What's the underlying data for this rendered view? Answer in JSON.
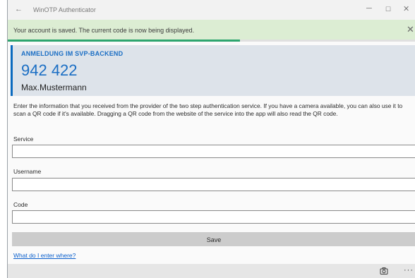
{
  "window": {
    "title": "WinOTP Authenticator",
    "back_glyph": "←",
    "minimize_glyph": "─",
    "maximize_glyph": "☐",
    "close_glyph": "✕"
  },
  "notification": {
    "message": "Your account is saved. The current code is now being displayed.",
    "close_glyph": "✕",
    "progress_fraction": 0.57
  },
  "account": {
    "label": "ANMELDUNG IM SVP-BACKEND",
    "code": "942 422",
    "username": "Max.Mustermann"
  },
  "form": {
    "description": "Enter the information that you received from the provider of the two step authentication service. If you have a camera available, you can also use it to scan a QR code if it's available. Dragging a QR code from the website of the service into the app will also read the QR code.",
    "service_label": "Service",
    "service_value": "",
    "username_label": "Username",
    "username_value": "",
    "code_label": "Code",
    "code_value": "",
    "save_label": "Save",
    "help_link": "What do I enter where?"
  },
  "appbar": {
    "camera_icon": "camera-icon",
    "more_glyph": "···"
  },
  "colors": {
    "accent": "#1a6ec4",
    "success_bg": "#dcedd3",
    "progress": "#2ea56f"
  }
}
